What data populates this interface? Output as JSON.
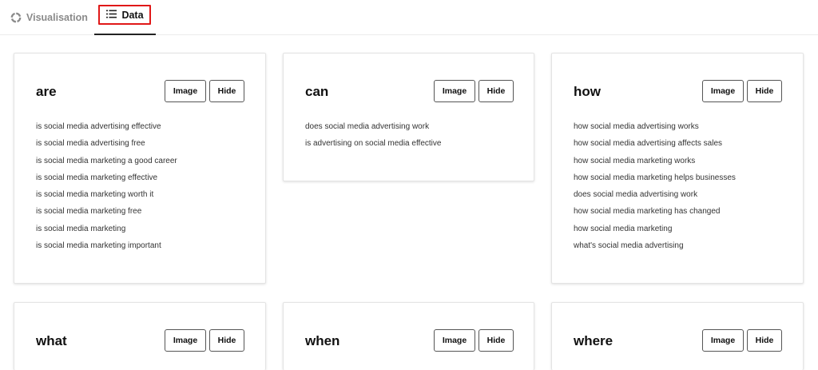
{
  "tabs": {
    "visualisation": {
      "label": "Visualisation",
      "icon": "ring-icon"
    },
    "data": {
      "label": "Data",
      "icon": "list-icon"
    }
  },
  "colors": {
    "highlight": "#e01818",
    "active": "#222222",
    "inactive": "#8a8a8a"
  },
  "cards": [
    {
      "title": "are",
      "image_label": "Image",
      "hide_label": "Hide",
      "items": [
        "is social media advertising effective",
        "is social media advertising free",
        "is social media marketing a good career",
        "is social media marketing effective",
        "is social media marketing worth it",
        "is social media marketing free",
        "is social media marketing",
        "is social media marketing important"
      ]
    },
    {
      "title": "can",
      "image_label": "Image",
      "hide_label": "Hide",
      "items": [
        "does social media advertising work",
        "is advertising on social media effective"
      ]
    },
    {
      "title": "how",
      "image_label": "Image",
      "hide_label": "Hide",
      "items": [
        "how social media advertising works",
        "how social media advertising affects sales",
        "how social media marketing works",
        "how social media marketing helps businesses",
        "does social media advertising work",
        "how social media marketing has changed",
        "how social media marketing",
        "what's social media advertising"
      ]
    },
    {
      "title": "what",
      "image_label": "Image",
      "hide_label": "Hide",
      "items": []
    },
    {
      "title": "when",
      "image_label": "Image",
      "hide_label": "Hide",
      "items": []
    },
    {
      "title": "where",
      "image_label": "Image",
      "hide_label": "Hide",
      "items": []
    }
  ]
}
